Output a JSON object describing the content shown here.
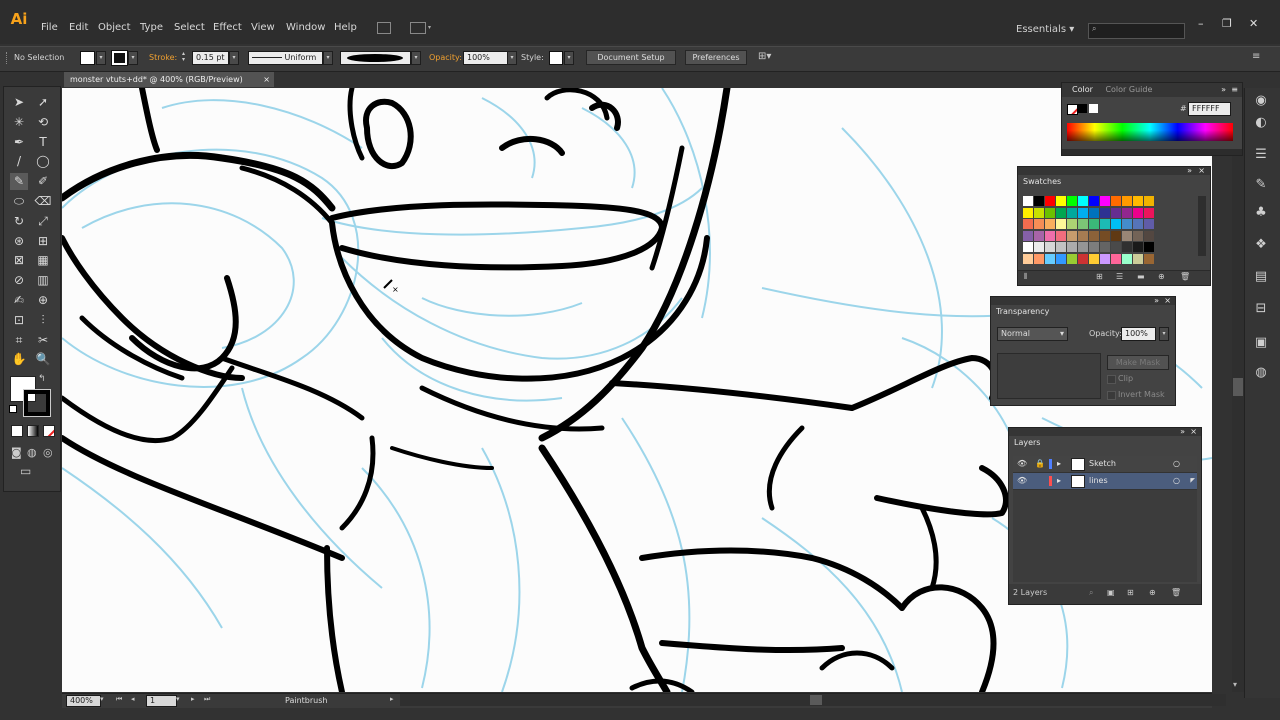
{
  "app": {
    "logo": "Ai"
  },
  "menu": [
    "File",
    "Edit",
    "Object",
    "Type",
    "Select",
    "Effect",
    "View",
    "Window",
    "Help"
  ],
  "workspace": {
    "name": "Essentials",
    "arrow": "▾"
  },
  "window_controls": {
    "minimize": "–",
    "maximize": "❐",
    "close": "✕"
  },
  "control_bar": {
    "selection": "No Selection",
    "stroke_label": "Stroke:",
    "stroke_value": "0.15 pt",
    "profile": "Uniform",
    "opacity_label": "Opacity:",
    "opacity_value": "100%",
    "style_label": "Style:",
    "document_setup": "Document Setup",
    "preferences": "Preferences"
  },
  "document": {
    "tab_title": "monster vtuts+dd* @ 400% (RGB/Preview)",
    "close": "×"
  },
  "tools": [
    "➤",
    "➚",
    "✳",
    "⟲",
    "✒",
    "T",
    "/",
    "◯",
    "✎",
    "✐",
    "⬭",
    "⌫",
    "↻",
    "⤢",
    "⊛",
    "⊞",
    "⊠",
    "▦",
    "⊘",
    "▥",
    "✍",
    "⊕",
    "⊡",
    "⫶",
    "⌗",
    "✂",
    "✋",
    "🔍"
  ],
  "panels": {
    "color": {
      "tab_active": "Color",
      "tab_inactive": "Color Guide",
      "hex_label": "#",
      "hex_value": "FFFFFF"
    },
    "swatches": {
      "title": "Swatches"
    },
    "transparency": {
      "title": "Transparency",
      "blend_mode": "Normal",
      "opacity_label": "Opacity:",
      "opacity_value": "100%",
      "make_mask": "Make Mask",
      "clip": "Clip",
      "invert_mask": "Invert Mask"
    },
    "layers": {
      "title": "Layers",
      "rows": [
        {
          "name": "Sketch",
          "color": "#4f7fff",
          "locked": true,
          "selected": false
        },
        {
          "name": "lines",
          "color": "#ff4f4f",
          "locked": false,
          "selected": true
        }
      ],
      "count": "2 Layers"
    }
  },
  "status_bar": {
    "zoom": "400%",
    "page": "1",
    "tool": "Paintbrush"
  },
  "colors": {
    "accent": "#f7a21b",
    "sketch_blue": "#6fc3e0",
    "ink": "#000000",
    "canvas": "#fcfcfc",
    "swatches": [
      "#ffffff",
      "#000000",
      "#ff0000",
      "#ffff00",
      "#00ff00",
      "#00ffff",
      "#0000ff",
      "#ff00ff",
      "#ff6b00",
      "#ff9a00",
      "#ffba00",
      "#f2b200",
      "#ffee00",
      "#c8e000",
      "#6cc000",
      "#00a651",
      "#00a99d",
      "#00aeef",
      "#0072bc",
      "#2e3192",
      "#662d91",
      "#92278f",
      "#ec008c",
      "#ed145b",
      "#f26c4f",
      "#f68e56",
      "#fbaf5d",
      "#fff799",
      "#acd373",
      "#7cc576",
      "#3bb878",
      "#1cbbb4",
      "#00bff3",
      "#448ccb",
      "#5674b9",
      "#605ca8",
      "#8560a8",
      "#a864a8",
      "#f06eaa",
      "#f26d7d",
      "#c69c6d",
      "#a67c52",
      "#8c6239",
      "#754c24",
      "#603913",
      "#998675",
      "#736357",
      "#534741",
      "#ffffff",
      "#ebebeb",
      "#d7d7d7",
      "#c2c2c2",
      "#acacac",
      "#959595",
      "#7d7d7d",
      "#646464",
      "#4a4a4a",
      "#303030",
      "#1a1a1a",
      "#000000",
      "#ffcc99",
      "#ff9966",
      "#66ccff",
      "#3399ff",
      "#99cc33",
      "#cc3333",
      "#ffcc33",
      "#cc99ff",
      "#ff6699",
      "#99ffcc",
      "#cccc99",
      "#996633"
    ]
  }
}
